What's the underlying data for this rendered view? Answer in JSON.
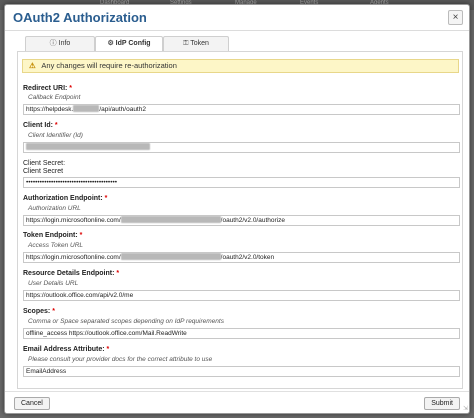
{
  "background_tabs": [
    "Dashboard",
    "Settings",
    "Manage",
    "Events",
    "Agents"
  ],
  "dialog": {
    "title": "OAuth2 Authorization",
    "close_icon": "×"
  },
  "tabs": [
    {
      "icon": "info-icon",
      "label": "Info",
      "active": false
    },
    {
      "icon": "gear-icon",
      "label": "IdP Config",
      "active": true
    },
    {
      "icon": "key-icon",
      "label": "Token",
      "active": false
    }
  ],
  "warning": {
    "icon": "warning-icon",
    "text": "Any changes will require re-authorization"
  },
  "fields": {
    "redirect_uri": {
      "label": "Redirect URI:",
      "required": "*",
      "hint": "Callback Endpoint",
      "value_prefix": "https://helpdesk.",
      "value_suffix": "/api/auth/oauth2"
    },
    "client_id": {
      "label": "Client Id:",
      "required": "*",
      "hint": "Client Identifier (Id)",
      "value": ""
    },
    "client_secret": {
      "label1": "Client Secret:",
      "label2": "Client Secret",
      "value": "••••••••••••••••••••••••••••••••••••••••"
    },
    "authorization_endpoint": {
      "label": "Authorization Endpoint:",
      "required": "*",
      "hint": "Authorization URL",
      "value_prefix": "https://login.microsoftonline.com/",
      "value_suffix": "/oauth2/v2.0/authorize"
    },
    "token_endpoint": {
      "label": "Token Endpoint:",
      "required": "*",
      "hint": "Access Token URL",
      "value_prefix": "https://login.microsoftonline.com/",
      "value_suffix": "/oauth2/v2.0/token"
    },
    "resource_details_endpoint": {
      "label": "Resource Details Endpoint:",
      "required": "*",
      "hint": "User Details URL",
      "value": "https://outlook.office.com/api/v2.0/me"
    },
    "scopes": {
      "label": "Scopes:",
      "required": "*",
      "hint": "Comma or Space separated scopes depending on IdP requirements",
      "value": "offline_access https://outlook.office.com/Mail.ReadWrite"
    },
    "email_attribute": {
      "label": "Email Address Attribute:",
      "required": "*",
      "hint": "Please consult your provider docs for the correct attribute to use",
      "value": "EmailAddress"
    }
  },
  "footer": {
    "cancel_label": "Cancel",
    "submit_label": "Submit"
  }
}
